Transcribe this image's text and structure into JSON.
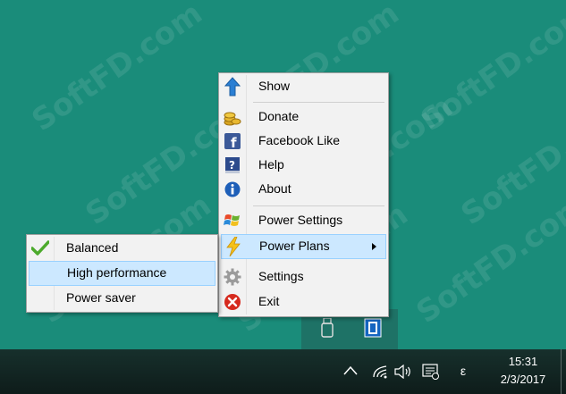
{
  "watermark": "SoftFD.com",
  "menu": {
    "items": [
      {
        "label": "Show",
        "icon": "up-arrow-icon"
      },
      {
        "label": "Donate",
        "icon": "coins-icon"
      },
      {
        "label": "Facebook Like",
        "icon": "facebook-icon"
      },
      {
        "label": "Help",
        "icon": "help-book-icon"
      },
      {
        "label": "About",
        "icon": "info-icon"
      },
      {
        "label": "Power Settings",
        "icon": "windows-flag-icon"
      },
      {
        "label": "Power Plans",
        "icon": "lightning-icon"
      },
      {
        "label": "Settings",
        "icon": "gear-icon"
      },
      {
        "label": "Exit",
        "icon": "exit-icon"
      }
    ]
  },
  "submenu": {
    "items": [
      {
        "label": "Balanced",
        "checked": true
      },
      {
        "label": "High performance",
        "checked": false
      },
      {
        "label": "Power saver",
        "checked": false
      }
    ]
  },
  "taskbar": {
    "time": "15:31",
    "date": "2/3/2017",
    "lang": "ε"
  },
  "colors": {
    "desktop": "#1a8c7a",
    "menu_bg": "#f2f2f2",
    "highlight": "#cce8ff",
    "highlight_border": "#99d1ff"
  }
}
